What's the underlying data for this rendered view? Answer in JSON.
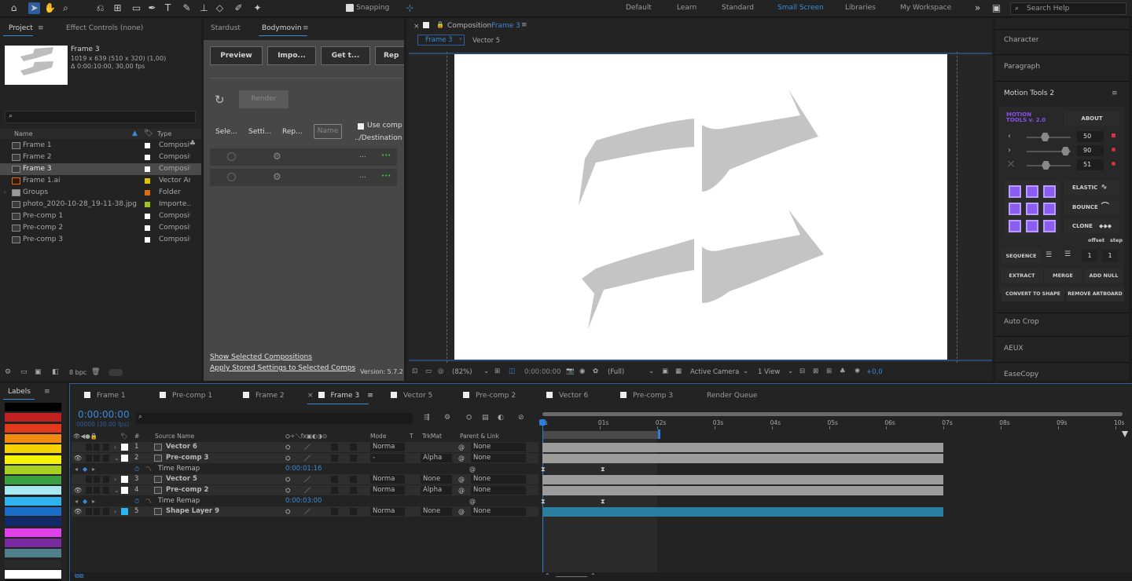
{
  "toolbar": {
    "snapping_label": "Snapping",
    "workspaces": [
      {
        "label": "Default",
        "active": false
      },
      {
        "label": "Learn",
        "active": false
      },
      {
        "label": "Standard",
        "active": false
      },
      {
        "label": "Small Screen",
        "active": true
      },
      {
        "label": "Libraries",
        "active": false
      },
      {
        "label": "My Workspace",
        "active": false
      }
    ],
    "search_placeholder": "Search Help"
  },
  "project": {
    "tab_label": "Project",
    "effects_tab_label": "Effect Controls (none)",
    "selected_name": "Frame 3",
    "selected_dims": "1019 x 639  (510 x 320) (1,00)",
    "selected_duration": "Δ 0:00:10:00, 30,00 fps",
    "col_name": "Name",
    "col_type": "Type",
    "bpc": "8 bpc",
    "items": [
      {
        "name": "Frame 1",
        "type": "Composit",
        "color": "#ffffff",
        "icon": "comp-icon",
        "selected": false
      },
      {
        "name": "Frame 2",
        "type": "Composit",
        "color": "#ffffff",
        "icon": "comp-icon",
        "selected": false
      },
      {
        "name": "Frame 3",
        "type": "Composit",
        "color": "#ffffff",
        "icon": "comp-icon",
        "selected": true
      },
      {
        "name": "Frame 1.ai",
        "type": "Vector Ar",
        "color": "#e2c200",
        "icon": "ai-file-icon",
        "selected": false
      },
      {
        "name": "Groups",
        "type": "Folder",
        "color": "#e06a10",
        "icon": "folder-icon",
        "selected": false
      },
      {
        "name": "photo_2020-10-28_19-11-38.jpg",
        "type": "Importe...",
        "color": "#9ac41e",
        "icon": "image-icon",
        "selected": false
      },
      {
        "name": "Pre-comp 1",
        "type": "Composit",
        "color": "#ffffff",
        "icon": "comp-icon",
        "selected": false
      },
      {
        "name": "Pre-comp 2",
        "type": "Composit",
        "color": "#ffffff",
        "icon": "comp-icon",
        "selected": false
      },
      {
        "name": "Pre-comp 3",
        "type": "Composit",
        "color": "#ffffff",
        "icon": "comp-icon",
        "selected": false
      }
    ]
  },
  "bodymovin": {
    "tab_stardust": "Stardust",
    "tab_bodymovin": "Bodymovin",
    "buttons": [
      "Preview",
      "Impo...",
      "Get t...",
      "Rep"
    ],
    "render_label": "Render",
    "col_select": "Sele...",
    "col_settings": "Setti...",
    "col_report": "Rep...",
    "name_placeholder": "Name",
    "use_comp_label": "Use comp",
    "destination": "../Destination",
    "row_ellipsis": "...",
    "row_more": "•••",
    "link_show": "Show Selected Compositions",
    "link_apply": "Apply Stored Settings to Selected Comps",
    "version": "Version: 5.7.2"
  },
  "composition": {
    "tab_prefix": "Composition",
    "tab_name": "Frame 3",
    "breadcrumb": [
      "Frame 3",
      "Vector 5"
    ],
    "zoom": "(82%)",
    "timecode": "0:00:00:00",
    "resolution": "(Full)",
    "camera": "Active Camera",
    "views": "1 View",
    "exposure": "+0,0"
  },
  "right_panels": {
    "character": "Character",
    "paragraph": "Paragraph",
    "motion_tools": "Motion Tools 2",
    "mt_logo_line1": "MOTION",
    "mt_logo_line2": "TOOLS v. 2.0",
    "about": "ABOUT",
    "sliders": [
      {
        "value": "50",
        "fill": 0.45
      },
      {
        "value": "90",
        "fill": 0.95
      },
      {
        "value": "51",
        "fill": 0.46
      }
    ],
    "elastic": "ELASTIC",
    "bounce": "BOUNCE",
    "clone": "CLONE",
    "offset": "offset",
    "step": "step",
    "sequence": "SEQUENCE",
    "seq_val1": "1",
    "seq_val2": "1",
    "extract": "EXTRACT",
    "merge": "MERGE",
    "add_null": "ADD NULL",
    "convert": "CONVERT TO SHAPE",
    "remove_artboard": "REMOVE ARTBOARD",
    "auto_crop": "Auto Crop",
    "aeux": "AEUX",
    "easecopy": "EaseCopy"
  },
  "labels": {
    "title": "Labels",
    "colors": [
      "#000000",
      "#c02020",
      "#e23a1a",
      "#f08a10",
      "#f5d200",
      "#f6f300",
      "#a8d020",
      "#3aa040",
      "#a8e8f0",
      "#30b4f0",
      "#1a6ec8",
      "#102a6a",
      "#e040e8",
      "#7a2aa0",
      "#50808c",
      "#2a2a2a",
      "#ffffff",
      "#000000"
    ]
  },
  "timeline": {
    "tabs": [
      {
        "label": "Frame 1",
        "active": false,
        "box": true
      },
      {
        "label": "Pre-comp 1",
        "active": false,
        "box": true
      },
      {
        "label": "Frame 2",
        "active": false,
        "box": true
      },
      {
        "label": "Frame 3",
        "active": true,
        "box": true
      },
      {
        "label": "Vector 5",
        "active": false,
        "box": true
      },
      {
        "label": "Pre-comp 2",
        "active": false,
        "box": true
      },
      {
        "label": "Vector 6",
        "active": false,
        "box": true
      },
      {
        "label": "Pre-comp 3",
        "active": false,
        "box": true
      },
      {
        "label": "Render Queue",
        "active": false,
        "box": false
      }
    ],
    "timecode": "0:00:00:00",
    "frame_info": "00000 (30.00 fps)",
    "col_source": "Source Name",
    "col_mode": "Mode",
    "col_t": "T",
    "col_trkmat": "TrkMat",
    "col_parent": "Parent & Link",
    "ruler": [
      "0s",
      "01s",
      "02s",
      "03s",
      "04s",
      "05s",
      "06s",
      "07s",
      "08s",
      "09s",
      "10s"
    ],
    "rows": [
      {
        "num": "1",
        "name": "Vector 6",
        "mode": "Norma",
        "trkmat": "",
        "parent": "None",
        "kind": "layer",
        "color": "#ffffff",
        "eye": false
      },
      {
        "num": "2",
        "name": "Pre-comp 3",
        "mode": "-",
        "trkmat": "Alpha",
        "parent": "None",
        "kind": "layer",
        "color": "#ffffff",
        "eye": true
      },
      {
        "num": "",
        "name": "Time Remap",
        "value": "0:00:01:16",
        "kind": "prop"
      },
      {
        "num": "3",
        "name": "Vector 5",
        "mode": "Norma",
        "trkmat": "None",
        "parent": "None",
        "kind": "layer",
        "color": "#ffffff",
        "eye": false
      },
      {
        "num": "4",
        "name": "Pre-comp 2",
        "mode": "Norma",
        "trkmat": "Alpha",
        "parent": "None",
        "kind": "layer",
        "color": "#ffffff",
        "eye": true
      },
      {
        "num": "",
        "name": "Time Remap",
        "value": "0:00:03:00",
        "kind": "prop"
      },
      {
        "num": "5",
        "name": "Shape Layer 9",
        "mode": "Norma",
        "trkmat": "None",
        "parent": "None",
        "kind": "layer",
        "color": "#2ab4f0",
        "eye": true
      }
    ]
  }
}
